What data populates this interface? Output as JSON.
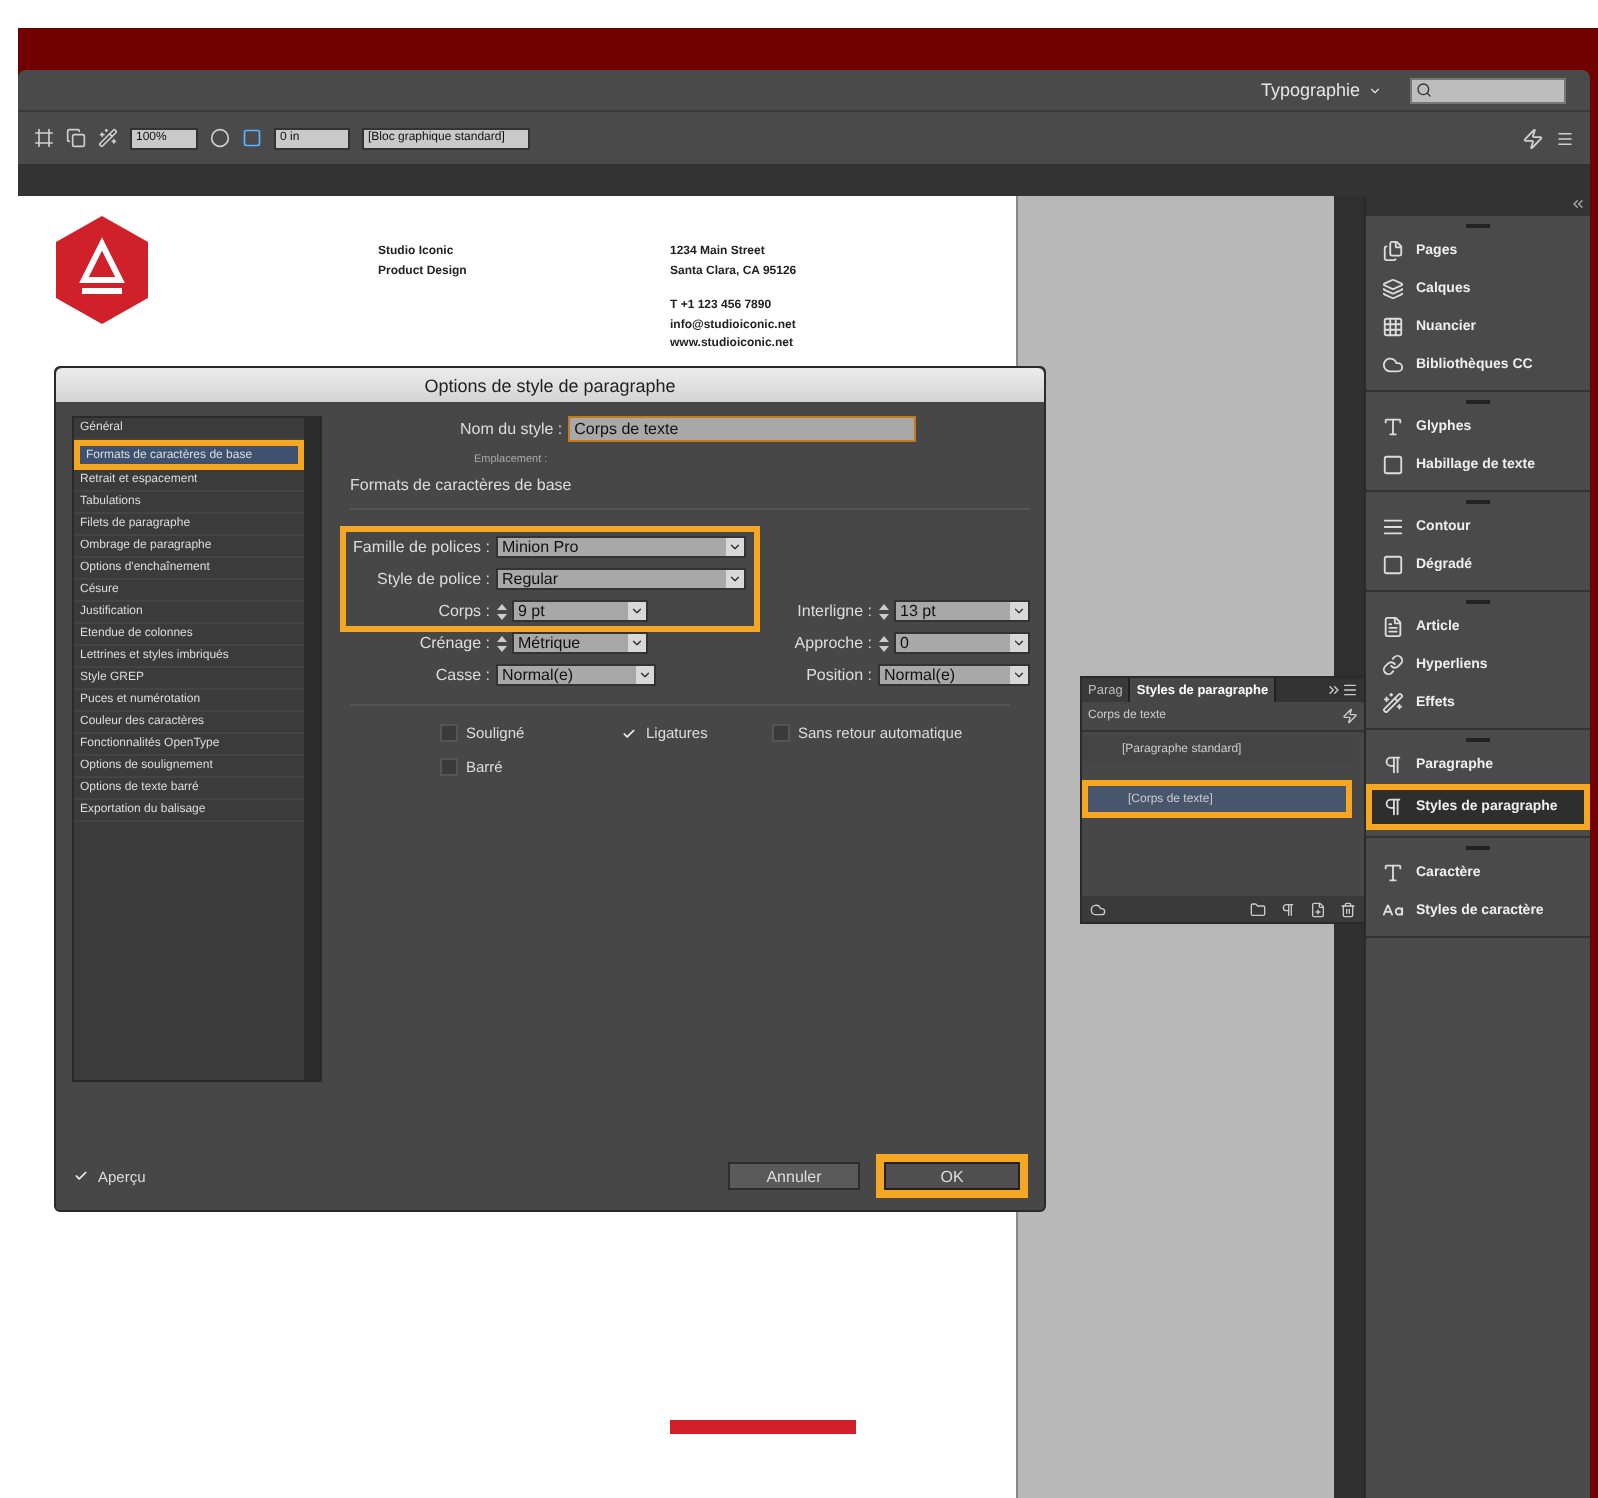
{
  "app": {
    "workspace": "Typographie"
  },
  "control_bar": {
    "stroke_weight": "0 in",
    "object_style": "[Bloc graphique standard]",
    "opacity": "100%"
  },
  "document": {
    "company": [
      "Studio Iconic",
      "Product Design"
    ],
    "address": [
      "1234 Main Street",
      "Santa Clara, CA 95126"
    ],
    "contact": [
      "T +1 123 456 7890",
      "info@studioiconic.net",
      "www.studioiconic.net"
    ]
  },
  "dialog": {
    "title": "Options de style de paragraphe",
    "categories": [
      {
        "label": "Général",
        "selected": false,
        "highlighted": false
      },
      {
        "label": "Formats de caractères de base",
        "selected": true,
        "highlighted": true
      },
      {
        "label": "Retrait et espacement",
        "selected": false,
        "highlighted": false
      },
      {
        "label": "Tabulations",
        "selected": false,
        "highlighted": false
      },
      {
        "label": "Filets de paragraphe",
        "selected": false,
        "highlighted": false
      },
      {
        "label": "Ombrage de paragraphe",
        "selected": false,
        "highlighted": false
      },
      {
        "label": "Options d'enchaînement",
        "selected": false,
        "highlighted": false
      },
      {
        "label": "Césure",
        "selected": false,
        "highlighted": false
      },
      {
        "label": "Justification",
        "selected": false,
        "highlighted": false
      },
      {
        "label": "Etendue de colonnes",
        "selected": false,
        "highlighted": false
      },
      {
        "label": "Lettrines et styles imbriqués",
        "selected": false,
        "highlighted": false
      },
      {
        "label": "Style GREP",
        "selected": false,
        "highlighted": false
      },
      {
        "label": "Puces et numérotation",
        "selected": false,
        "highlighted": false
      },
      {
        "label": "Couleur des caractères",
        "selected": false,
        "highlighted": false
      },
      {
        "label": "Fonctionnalités OpenType",
        "selected": false,
        "highlighted": false
      },
      {
        "label": "Options de soulignement",
        "selected": false,
        "highlighted": false
      },
      {
        "label": "Options de texte barré",
        "selected": false,
        "highlighted": false
      },
      {
        "label": "Exportation du balisage",
        "selected": false,
        "highlighted": false
      }
    ],
    "style_name_label": "Nom du style :",
    "style_name": "Corps de texte",
    "location_label": "Emplacement :",
    "section_title": "Formats de caractères de base",
    "font_block_highlighted": true,
    "fields": [
      {
        "label": "Famille de polices :",
        "value": "Minion Pro",
        "kind": "select"
      },
      {
        "label": "Style de police :",
        "value": "Regular",
        "kind": "select"
      },
      {
        "label": "Corps :",
        "value": "9 pt",
        "kind": "spin"
      },
      {
        "label": "Interligne :",
        "value": "13 pt",
        "kind": "spin"
      },
      {
        "label": "Crénage :",
        "value": "Métrique",
        "kind": "spin"
      },
      {
        "label": "Approche :",
        "value": "0",
        "kind": "spin"
      },
      {
        "label": "Casse :",
        "value": "Normal(e)",
        "kind": "select"
      },
      {
        "label": "Position :",
        "value": "Normal(e)",
        "kind": "select"
      }
    ],
    "checkboxes": [
      {
        "label": "Souligné",
        "checked": false
      },
      {
        "label": "Ligatures",
        "checked": true
      },
      {
        "label": "Sans retour automatique",
        "checked": false
      },
      {
        "label": "Barré",
        "checked": false
      }
    ],
    "preview": {
      "label": "Aperçu",
      "checked": true
    },
    "buttons": [
      {
        "label": "Annuler",
        "kind": "cancel",
        "highlighted": false
      },
      {
        "label": "OK",
        "kind": "default",
        "highlighted": true
      }
    ]
  },
  "styles_panel": {
    "tabs": [
      {
        "label": "Parag",
        "selected": false
      },
      {
        "label": "Styles de paragraphe",
        "selected": true
      }
    ],
    "current": "Corps de texte",
    "items": [
      {
        "label": "[Paragraphe standard]",
        "selected": false,
        "highlighted": false
      },
      {
        "label": "[Corps de texte]",
        "selected": true,
        "highlighted": true
      }
    ]
  },
  "dock": {
    "groups": [
      {
        "items": [
          {
            "label": "Pages",
            "selected": false
          },
          {
            "label": "Calques",
            "selected": false
          },
          {
            "label": "Nuancier",
            "selected": false
          },
          {
            "label": "Bibliothèques CC",
            "selected": false
          }
        ]
      },
      {
        "items": [
          {
            "label": "Glyphes",
            "selected": false
          },
          {
            "label": "Habillage de texte",
            "selected": false
          }
        ]
      },
      {
        "items": [
          {
            "label": "Contour",
            "selected": false
          },
          {
            "label": "Dégradé",
            "selected": false
          }
        ]
      },
      {
        "items": [
          {
            "label": "Article",
            "selected": false
          },
          {
            "label": "Hyperliens",
            "selected": false
          },
          {
            "label": "Effets",
            "selected": false
          }
        ]
      },
      {
        "items": [
          {
            "label": "Paragraphe",
            "selected": false
          },
          {
            "label": "Styles de paragraphe",
            "selected": true
          }
        ]
      },
      {
        "items": [
          {
            "label": "Caractère",
            "selected": false
          },
          {
            "label": "Styles de caractère",
            "selected": false
          }
        ]
      }
    ]
  }
}
